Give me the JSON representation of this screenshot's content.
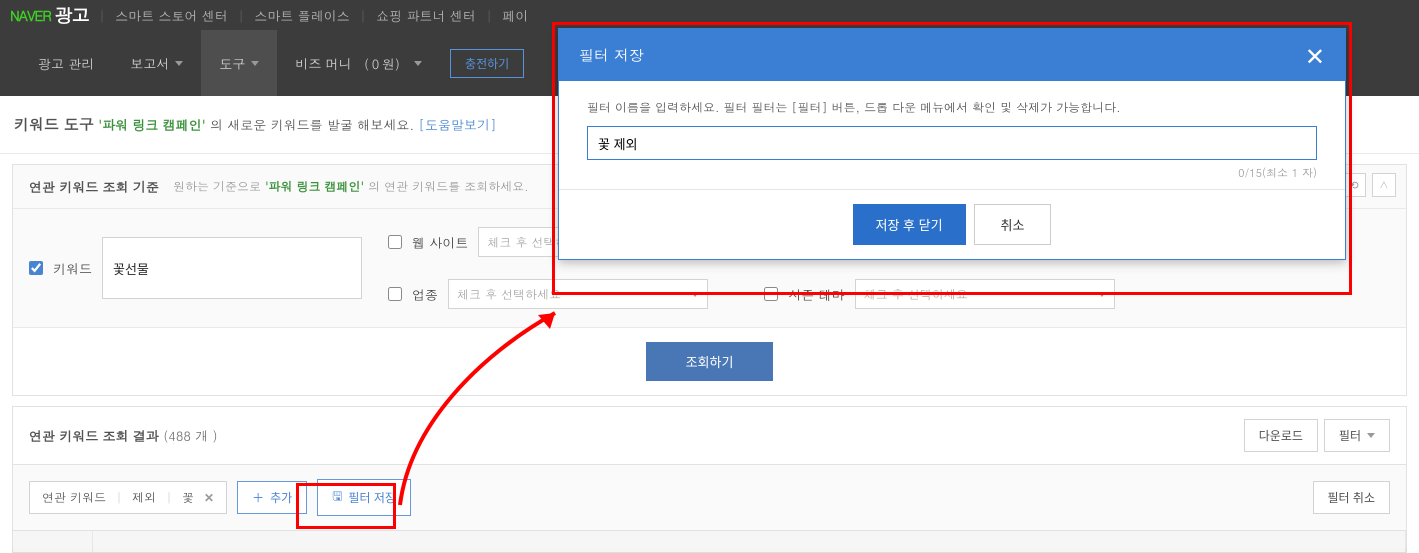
{
  "topbar": {
    "naver": "NAVER",
    "ad": "광고",
    "links": [
      "스마트 스토어 센터",
      "스마트 플레이스",
      "쇼핑 파트너 센터",
      "페이"
    ]
  },
  "nav": {
    "items": [
      "광고 관리",
      "보고서",
      "도구",
      "비즈 머니 （０원）"
    ],
    "charge": "충전하기"
  },
  "subheader": {
    "title": "키워드 도구",
    "em": "'파워 링크 캠페인'",
    "text": "의 새로운 키워드를 발굴 해보세요.",
    "help": "[도움말보기]"
  },
  "criteria": {
    "title": "연관 키워드 조회 기준",
    "sub_pre": "원하는 기준으로",
    "sub_em": "'파워 링크 캠페인'",
    "sub_post": "의 연관 키워드를 조회하세요.",
    "keyword_label": "키워드",
    "keyword_value": "꽃선물",
    "website_label": "웹 사이트",
    "industry_label": "업종",
    "season_label": "시즌 테마",
    "select_placeholder": "체크 후 선택하세요",
    "submit": "조회하기"
  },
  "results": {
    "title": "연관 키워드 조회 결과",
    "count": "(488 개 )",
    "download": "다운로드",
    "filter": "필터"
  },
  "chips": {
    "col": "연관 키워드",
    "op": "제외",
    "val": "꽃",
    "add": "추가",
    "save": "필터 저장",
    "cancel": "필터 취소"
  },
  "modal": {
    "title": "필터 저장",
    "msg": "필터 이름을 입력하세요. 필터 필터는 [필터] 버튼, 드롭 다운 메뉴에서 확인 및 삭제가 가능합니다.",
    "value": "꽃 제외",
    "count": "0/15(최소 1 자)",
    "save": "저장 후 닫기",
    "cancel": "취소"
  }
}
